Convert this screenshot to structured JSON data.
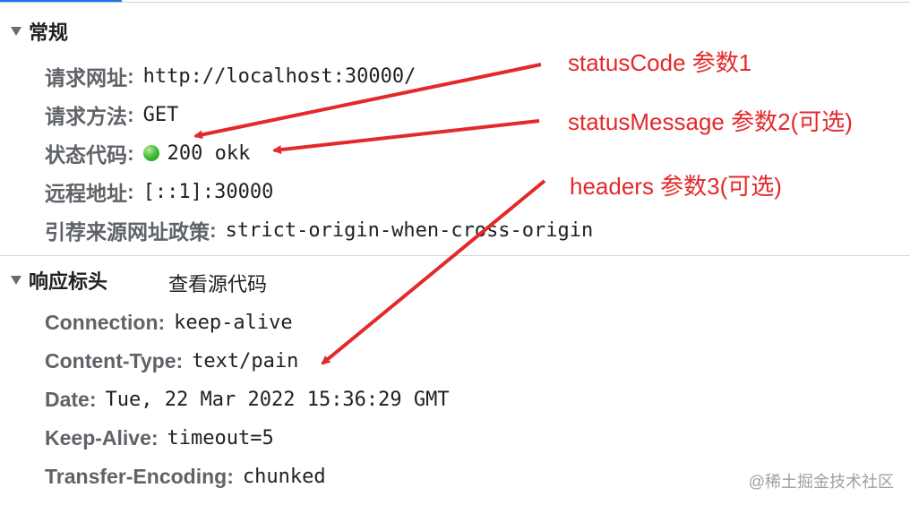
{
  "general": {
    "title": "常规",
    "rows": [
      {
        "key": "请求网址",
        "value": "http://localhost:30000/"
      },
      {
        "key": "请求方法",
        "value": "GET"
      },
      {
        "key": "状态代码",
        "value": "200 okk"
      },
      {
        "key": "远程地址",
        "value": "[::1]:30000"
      },
      {
        "key": "引荐来源网址政策",
        "value": "strict-origin-when-cross-origin"
      }
    ]
  },
  "response_headers": {
    "title": "响应标头",
    "view_source": "查看源代码",
    "rows": [
      {
        "key": "Connection",
        "value": "keep-alive"
      },
      {
        "key": "Content-Type",
        "value": "text/pain"
      },
      {
        "key": "Date",
        "value": "Tue, 22 Mar 2022 15:36:29 GMT"
      },
      {
        "key": "Keep-Alive",
        "value": "timeout=5"
      },
      {
        "key": "Transfer-Encoding",
        "value": "chunked"
      }
    ]
  },
  "annotations": [
    "statusCode 参数1",
    "statusMessage 参数2(可选)",
    "headers 参数3(可选)"
  ],
  "watermark": "@稀土掘金技术社区",
  "colors": {
    "annotation": "#e3292b",
    "status_dot": "#48c23a",
    "tab_accent": "#1a73e8"
  }
}
